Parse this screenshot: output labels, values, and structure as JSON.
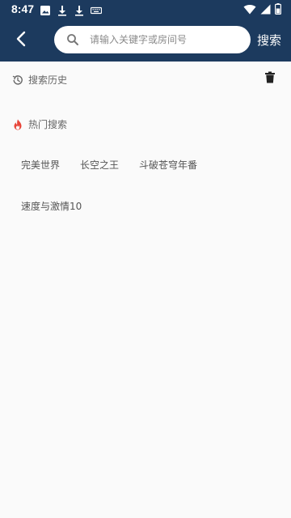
{
  "status_bar": {
    "time": "8:47",
    "left_icons": [
      "image-icon",
      "download-icon",
      "download-icon",
      "keyboard-icon"
    ],
    "right_icons": [
      "wifi-icon",
      "signal-icon",
      "battery-icon"
    ]
  },
  "header": {
    "background_color": "#1c3a5e",
    "back_icon": "chevron-left-icon",
    "search": {
      "placeholder": "请输入关键字或房间号",
      "value": ""
    },
    "search_button_label": "搜索"
  },
  "history": {
    "title": "搜索历史",
    "icon": "history-icon",
    "clear_icon": "trash-icon",
    "items": []
  },
  "hot": {
    "title": "热门搜索",
    "icon": "flame-icon",
    "icon_color": "#e8463a",
    "tags": [
      "完美世界",
      "长空之王",
      "斗破苍穹年番",
      "速度与激情10"
    ]
  }
}
